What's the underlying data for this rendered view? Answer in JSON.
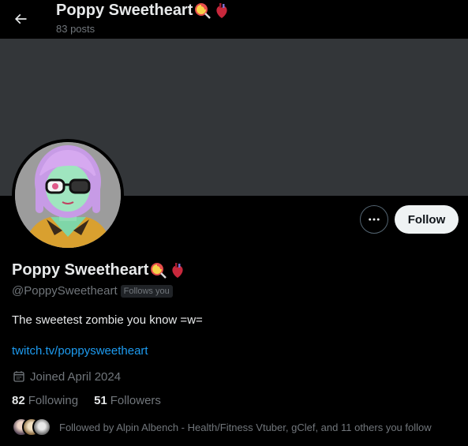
{
  "header": {
    "title": "Poppy Sweetheart",
    "post_count": "83 posts",
    "back_icon": "arrow-left-icon"
  },
  "profile": {
    "display_name": "Poppy Sweetheart",
    "name_emojis": [
      "lollipop-emoji",
      "anatomical-heart-emoji"
    ],
    "handle": "@PoppySweetheart",
    "follows_you": "Follows you",
    "bio": "The sweetest zombie you know =w=",
    "link": "twitch.tv/poppysweetheart",
    "joined": "Joined April 2024",
    "following_count": "82",
    "following_label": "Following",
    "followers_count": "51",
    "followers_label": "Followers",
    "followed_by": "Followed by Alpin Albench - Health/Fitness Vtuber, gClef, and 11 others you follow"
  },
  "actions": {
    "more_icon": "more-horizontal-icon",
    "follow_label": "Follow"
  },
  "colors": {
    "background": "#000000",
    "banner": "#333639",
    "link": "#1d9bf0",
    "muted": "#71767b",
    "text": "#e7e9ea",
    "follow_button": "#eff3f4"
  }
}
